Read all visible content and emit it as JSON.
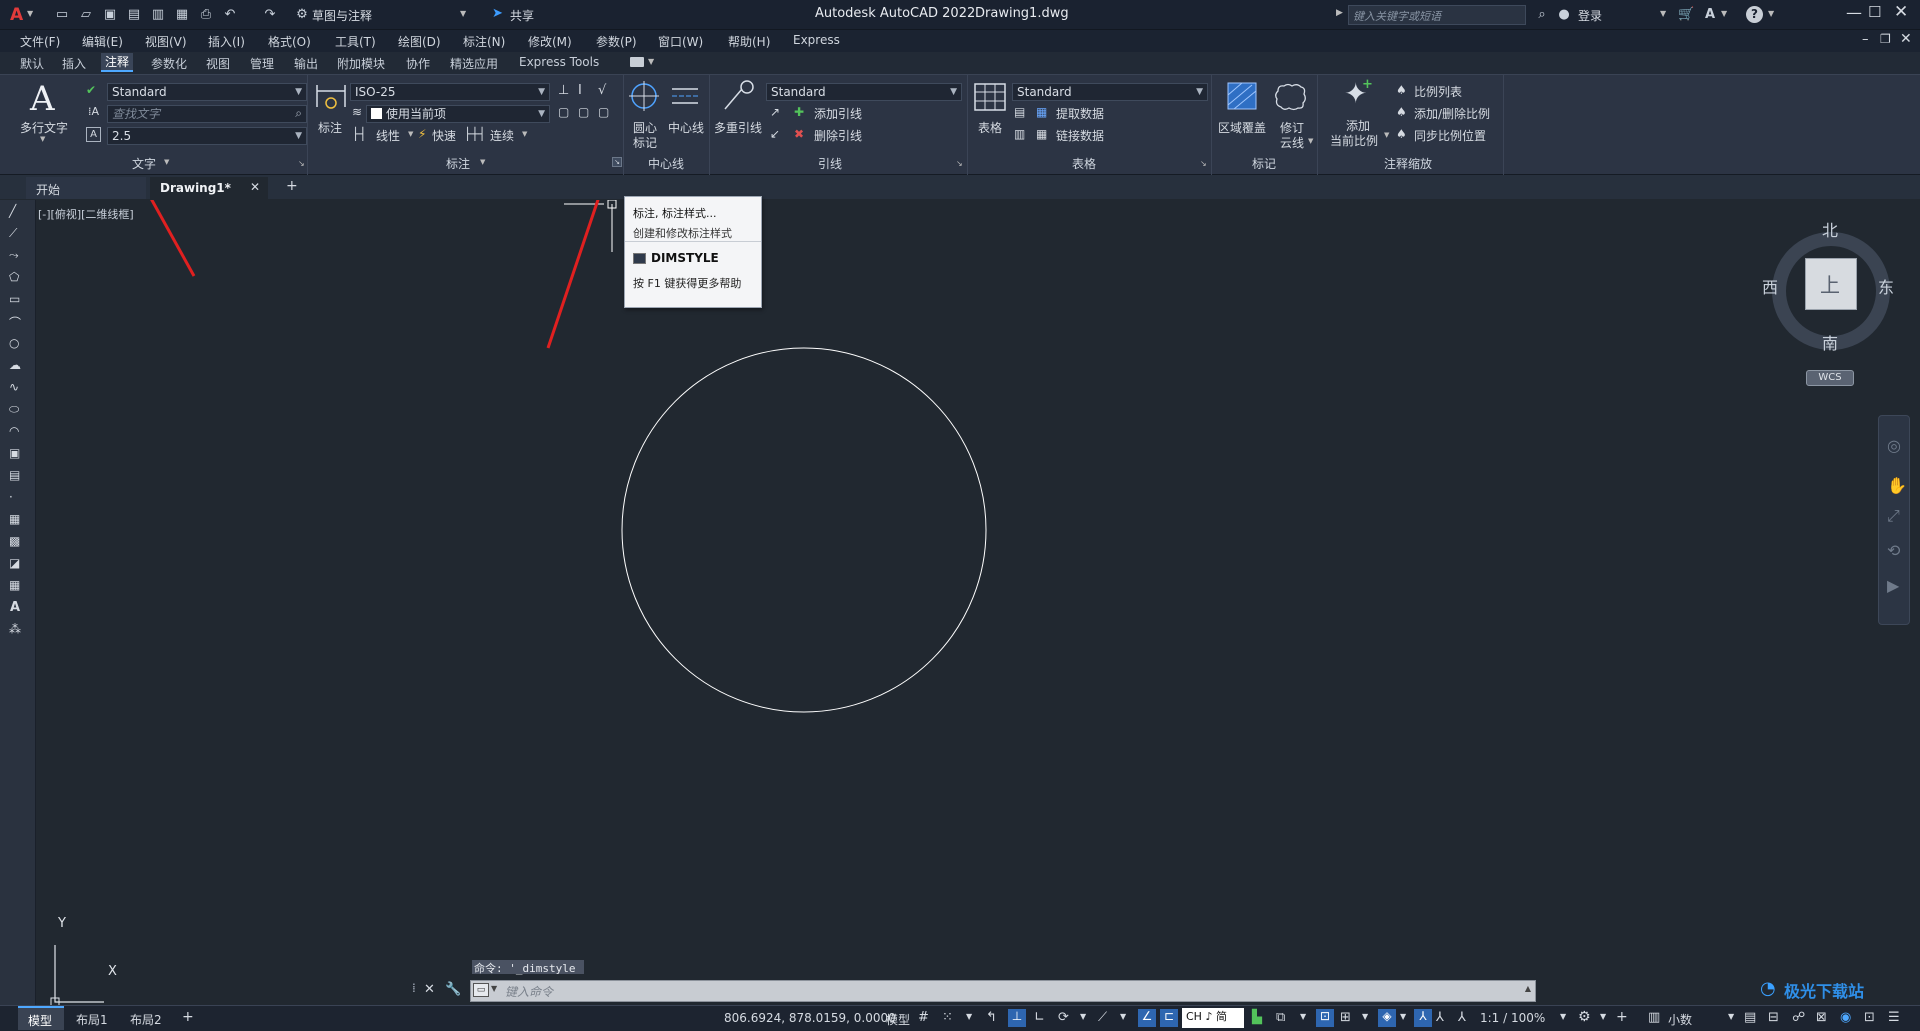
{
  "app": {
    "logo": "A",
    "title": "Autodesk AutoCAD 2022",
    "filename": "Drawing1.dwg"
  },
  "quick_access": {
    "workspace": "草图与注释",
    "share_label": "共享"
  },
  "top_right": {
    "search_placeholder": "键入关键字或短语",
    "login_label": "登录"
  },
  "menubar": [
    "文件(F)",
    "编辑(E)",
    "视图(V)",
    "插入(I)",
    "格式(O)",
    "工具(T)",
    "绘图(D)",
    "标注(N)",
    "修改(M)",
    "参数(P)",
    "窗口(W)",
    "帮助(H)",
    "Express"
  ],
  "ribbon_tabs": [
    "默认",
    "插入",
    "注释",
    "参数化",
    "视图",
    "管理",
    "输出",
    "附加模块",
    "协作",
    "精选应用",
    "Express Tools"
  ],
  "ribbon_active_tab": "注释",
  "text_panel": {
    "big_label": "多行文字",
    "style_value": "Standard",
    "find_placeholder": "查找文字",
    "height_value": "2.5",
    "panel_label": "文字"
  },
  "dim_panel": {
    "big_label": "标注",
    "style_value": "ISO-25",
    "layer_value": "使用当前项",
    "linear_label": "线性",
    "quick_label": "快速",
    "continue_label": "连续",
    "panel_label": "标注"
  },
  "centerline_panel": {
    "center_mark": "圆心\n标记",
    "center_mark_l1": "圆心",
    "center_mark_l2": "标记",
    "centerline": "中心线",
    "panel_label": "中心线"
  },
  "leader_panel": {
    "big_label": "多重引线",
    "style_value": "Standard",
    "add_leader": "添加引线",
    "remove_leader": "删除引线",
    "panel_label": "引线"
  },
  "table_panel": {
    "big_label": "表格",
    "style_value": "Standard",
    "extract": "提取数据",
    "link": "链接数据",
    "panel_label": "表格"
  },
  "markup_panel": {
    "wipeout": "区域覆盖",
    "revcloud_l1": "修订",
    "revcloud_l2": "云线",
    "panel_label": "标记"
  },
  "scale_panel": {
    "add_scale_l1": "添加",
    "add_scale_l2": "当前比例",
    "scale_list": "比例列表",
    "add_delete": "添加/删除比例",
    "sync": "同步比例位置",
    "panel_label": "注释缩放"
  },
  "doc_tabs": {
    "start": "开始",
    "drawing": "Drawing1*"
  },
  "viewport_label": "[-][俯视][二维线框]",
  "tooltip": {
    "title": "标注, 标注样式...",
    "desc": "创建和修改标注样式",
    "command": "DIMSTYLE",
    "help": "按 F1 键获得更多帮助"
  },
  "viewcube": {
    "north": "北",
    "south": "南",
    "east": "东",
    "west": "西",
    "face": "上",
    "wcs": "WCS"
  },
  "ucs": {
    "x": "X",
    "y": "Y"
  },
  "command": {
    "history": "命令: '_dimstyle",
    "placeholder": "键入命令"
  },
  "layout_tabs": [
    "模型",
    "布局1",
    "布局2"
  ],
  "status": {
    "coords": "806.6924, 878.0159, 0.0000",
    "model": "模型",
    "ime": "CH ♪ 简",
    "scale": "1:1 / 100%",
    "units": "小数"
  },
  "watermark": "极光下载站"
}
